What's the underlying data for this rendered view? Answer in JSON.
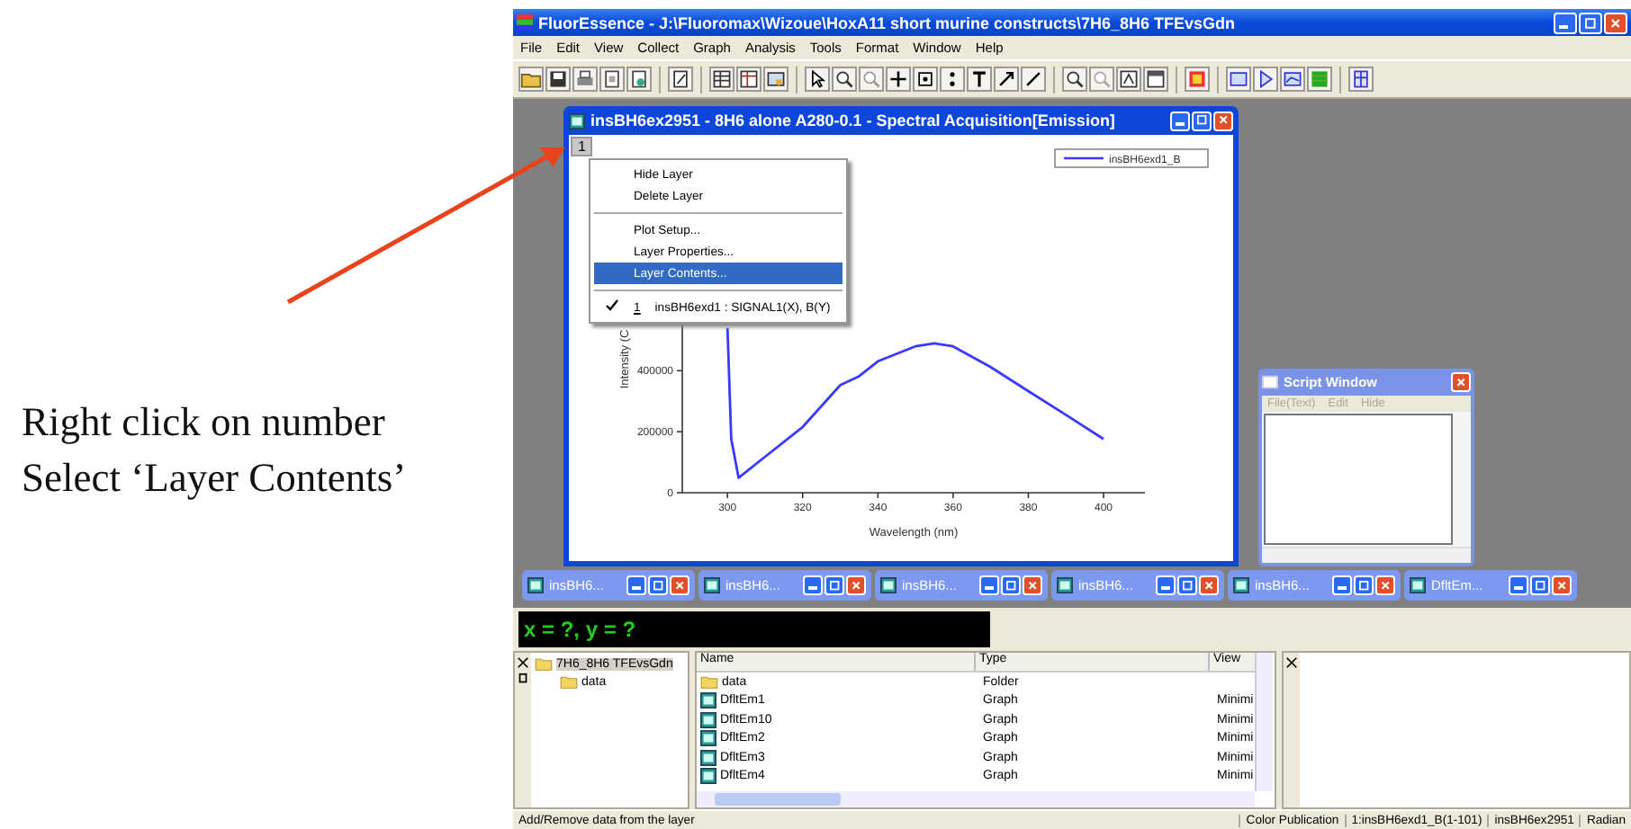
{
  "annotation": {
    "lines": [
      "Right click on number",
      "Select ‘Layer Contents’"
    ]
  },
  "window": {
    "title": "FluorEssence - J:\\Fluoromax\\Wizoue\\HoxA11 short murine constructs\\7H6_8H6 TFEvsGdn"
  },
  "menu": [
    "File",
    "Edit",
    "View",
    "Collect",
    "Graph",
    "Analysis",
    "Tools",
    "Format",
    "Window",
    "Help"
  ],
  "graph_window": {
    "title": "insBH6ex2951 - 8H6 alone A280-0.1 - Spectral Acquisition[Emission]",
    "layer_tab": "1",
    "chart_data": {
      "type": "line",
      "xlabel": "Wavelength (nm)",
      "ylabel": "Intensity (C",
      "x": [
        300,
        301,
        303,
        310,
        320,
        330,
        335,
        340,
        350,
        355,
        360,
        370,
        380,
        390,
        400
      ],
      "series": [
        {
          "name": "insBH6exd1_B",
          "color": "#3a3aff",
          "values": [
            540000,
            176000,
            49000,
            118000,
            216000,
            353000,
            382000,
            431000,
            480000,
            490000,
            480000,
            412000,
            333000,
            255000,
            176000
          ]
        }
      ],
      "xlim": [
        288,
        411
      ],
      "ylim": [
        0,
        560000
      ],
      "xticks": [
        300,
        320,
        340,
        360,
        380,
        400
      ],
      "yticks": [
        {
          "value": 0,
          "label": "0"
        },
        {
          "value": 200000,
          "label": "200000"
        },
        {
          "value": 400000,
          "label": "400000"
        }
      ]
    },
    "context_menu": [
      {
        "kind": "item",
        "label": "Hide Layer",
        "selected": false,
        "checked": false
      },
      {
        "kind": "item",
        "label": "Delete Layer",
        "selected": false,
        "checked": false
      },
      {
        "kind": "separator"
      },
      {
        "kind": "item",
        "label": "Plot Setup...",
        "selected": false,
        "checked": false
      },
      {
        "kind": "item",
        "label": "Layer Properties...",
        "selected": false,
        "checked": false
      },
      {
        "kind": "item",
        "label": "Layer Contents...",
        "selected": true,
        "checked": false
      },
      {
        "kind": "separator"
      },
      {
        "kind": "item",
        "label": "insBH6exd1 : SIGNAL1(X), B(Y)",
        "index": "1",
        "selected": false,
        "checked": true
      }
    ]
  },
  "minimized_windows": [
    {
      "label": "insBH6..."
    },
    {
      "label": "insBH6..."
    },
    {
      "label": "insBH6..."
    },
    {
      "label": "insBH6..."
    },
    {
      "label": "insBH6..."
    },
    {
      "label": "DfltEm..."
    }
  ],
  "script_window": {
    "title": "Script Window",
    "menu": [
      {
        "label": "File(Text)",
        "disabled": true
      },
      {
        "label": "Edit",
        "disabled": true
      },
      {
        "label": "Hide",
        "disabled": true
      }
    ]
  },
  "coordinates": "x = ?, y = ?",
  "project_tree": [
    {
      "label": "7H6_8H6 TFEvsGdn",
      "selected": true,
      "children": [
        {
          "label": "data",
          "selected": false
        }
      ]
    }
  ],
  "file_list": {
    "columns": [
      "Name",
      "Type",
      "View"
    ],
    "rows": [
      {
        "kind": "folder",
        "name": "data",
        "type": "Folder"
      },
      {
        "kind": "graph",
        "name": "DfltEm1",
        "type": "Graph",
        "view": "Minimi"
      },
      {
        "kind": "graph",
        "name": "DfltEm10",
        "type": "Graph",
        "view": "Minimi"
      },
      {
        "kind": "graph",
        "name": "DfltEm2",
        "type": "Graph",
        "view": "Minimi"
      },
      {
        "kind": "graph",
        "name": "DfltEm3",
        "type": "Graph",
        "view": "Minimi"
      },
      {
        "kind": "graph",
        "name": "DfltEm4",
        "type": "Graph",
        "view": "Minimi"
      }
    ]
  },
  "status_bar": [
    "Add/Remove data from the layer",
    "Color Publication",
    "1:insBH6exd1_B(1-101)",
    "insBH6ex2951",
    "Radian"
  ]
}
